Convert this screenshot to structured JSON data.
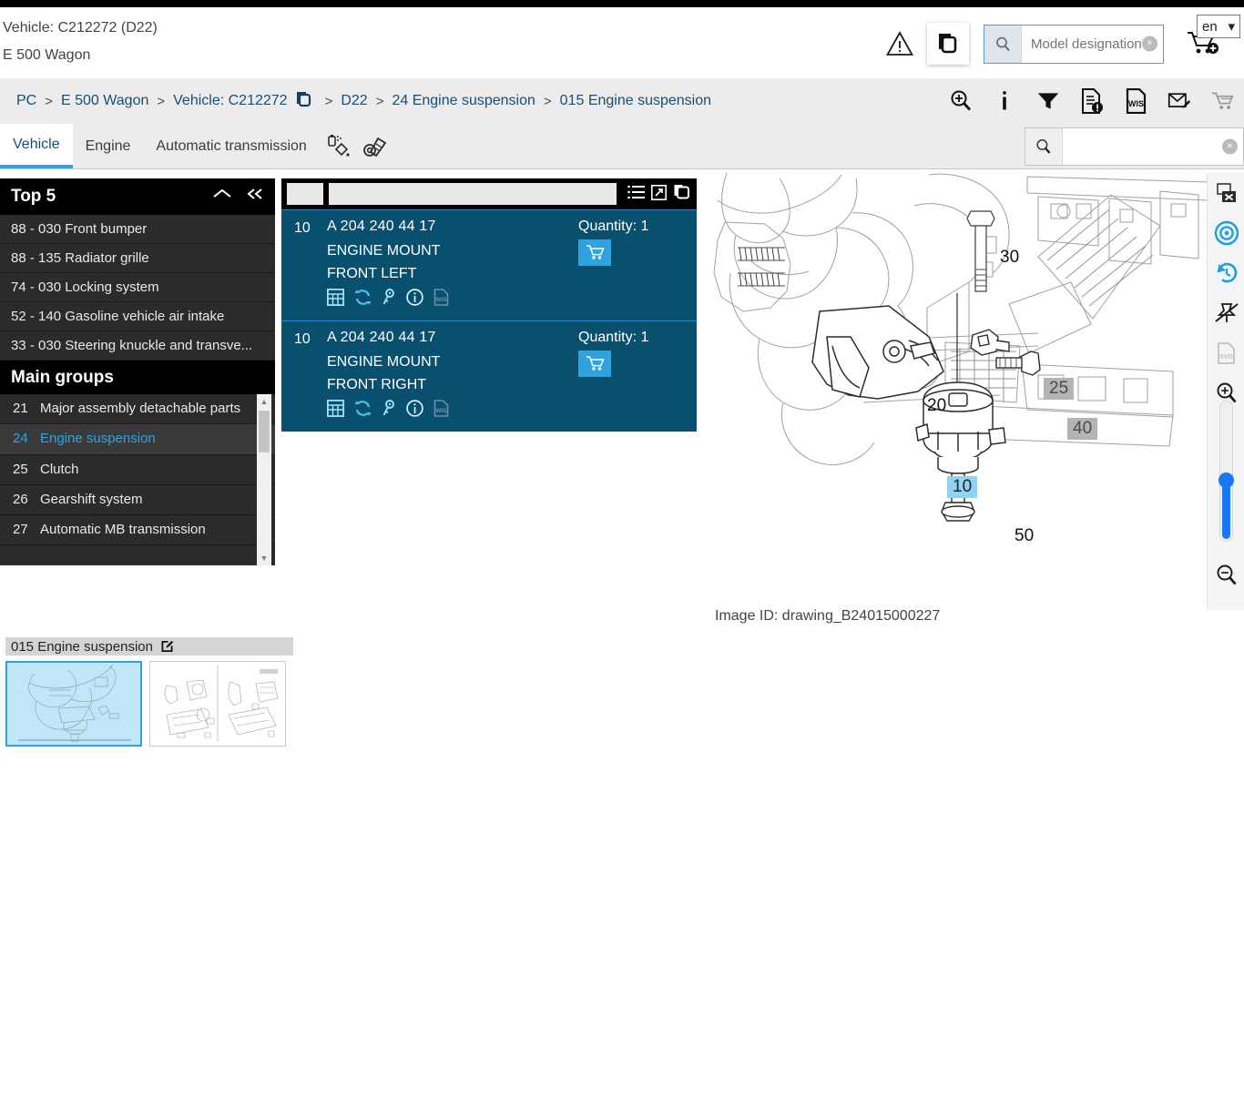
{
  "header": {
    "vehicle_title": "Vehicle: C212272 (D22)",
    "vehicle_model": "E 500 Wagon",
    "warning_icon": "warning-triangle-icon",
    "copy_icon": "copy-documents-icon",
    "search": {
      "placeholder": "Model designation",
      "value": "",
      "icon": "search-icon",
      "clear": "×"
    },
    "cart_icon": "add-to-cart-icon",
    "language": {
      "value": "en",
      "caret": "▾"
    }
  },
  "breadcrumb": {
    "items": [
      {
        "label": "PC"
      },
      {
        "label": "E 500 Wagon"
      },
      {
        "label": "Vehicle: C212272"
      },
      {
        "label": "D22"
      },
      {
        "label": "24 Engine suspension"
      },
      {
        "label": "015 Engine suspension"
      }
    ],
    "separator": ">",
    "tools": [
      {
        "name": "zoom-in-search-icon"
      },
      {
        "name": "info-icon"
      },
      {
        "name": "filter-icon"
      },
      {
        "name": "document-alert-icon"
      },
      {
        "name": "wis-document-icon"
      },
      {
        "name": "email-edit-icon"
      },
      {
        "name": "shopping-cart-icon"
      }
    ]
  },
  "tabs": {
    "items": [
      {
        "label": "Vehicle",
        "active": true
      },
      {
        "label": "Engine",
        "active": false
      },
      {
        "label": "Automatic transmission",
        "active": false
      }
    ],
    "icons": [
      {
        "name": "paint-color-icon"
      },
      {
        "name": "fastener-bolt-icon"
      }
    ],
    "search": {
      "placeholder": "",
      "value": "",
      "icon": "search-icon",
      "clear": "×"
    }
  },
  "sidebar": {
    "top5": {
      "title": "Top 5",
      "collapse_icon": "chevron-up-icon",
      "collapse_all_icon": "double-chevron-left-icon",
      "items": [
        {
          "label": "88 - 030 Front bumper"
        },
        {
          "label": "88 - 135 Radiator grille"
        },
        {
          "label": "74 - 030 Locking system"
        },
        {
          "label": "52 - 140 Gasoline vehicle air intake"
        },
        {
          "label": "33 - 030 Steering knuckle and transve..."
        }
      ]
    },
    "main_groups": {
      "title": "Main groups",
      "items": [
        {
          "num": "21",
          "label": "Major assembly detachable parts",
          "selected": false
        },
        {
          "num": "24",
          "label": "Engine suspension",
          "selected": true
        },
        {
          "num": "25",
          "label": "Clutch",
          "selected": false
        },
        {
          "num": "26",
          "label": "Gearshift system",
          "selected": false
        },
        {
          "num": "27",
          "label": "Automatic MB transmission",
          "selected": false
        }
      ]
    }
  },
  "parts_panel": {
    "header": {
      "list_view_icon": "list-view-icon",
      "expand_icon": "expand-diagonal-icon",
      "copy_icon": "copy-icon"
    },
    "rows": [
      {
        "index": "10",
        "part_number": "A 204 240 44 17",
        "desc_line1": "ENGINE MOUNT",
        "desc_line2": "FRONT LEFT",
        "quantity_label": "Quantity: 1",
        "cart_icon": "cart-icon",
        "icons": [
          {
            "name": "table-grid-icon"
          },
          {
            "name": "refresh-cycle-icon"
          },
          {
            "name": "key-icon"
          },
          {
            "name": "info-circle-icon"
          },
          {
            "name": "wis-document-icon"
          }
        ]
      },
      {
        "index": "10",
        "part_number": "A 204 240 44 17",
        "desc_line1": "ENGINE MOUNT",
        "desc_line2": "FRONT RIGHT",
        "quantity_label": "Quantity: 1",
        "cart_icon": "cart-icon",
        "icons": [
          {
            "name": "table-grid-icon"
          },
          {
            "name": "refresh-cycle-icon"
          },
          {
            "name": "key-icon"
          },
          {
            "name": "info-circle-icon"
          },
          {
            "name": "wis-document-icon"
          }
        ]
      }
    ]
  },
  "drawing": {
    "image_id_label": "Image ID: drawing_B24015000227",
    "callouts": [
      {
        "label": "30",
        "style": "plain"
      },
      {
        "label": "20",
        "style": "plain"
      },
      {
        "label": "25",
        "style": "gray"
      },
      {
        "label": "40",
        "style": "gray"
      },
      {
        "label": "10",
        "style": "blue"
      },
      {
        "label": "50",
        "style": "plain"
      }
    ]
  },
  "right_toolbar": {
    "items": [
      {
        "name": "close-window-icon"
      },
      {
        "name": "target-focus-icon"
      },
      {
        "name": "reset-history-icon"
      },
      {
        "name": "unpin-icon"
      },
      {
        "name": "svg-export-icon"
      },
      {
        "name": "zoom-in-icon"
      },
      {
        "name": "zoom-slider"
      },
      {
        "name": "zoom-out-icon"
      }
    ]
  },
  "thumbnails": {
    "title": "015 Engine suspension",
    "edit_icon": "edit-pencil-icon",
    "items": [
      {
        "name": "engine-suspension-drawing-1",
        "selected": true
      },
      {
        "name": "engine-suspension-drawing-2",
        "selected": false
      }
    ]
  },
  "colors": {
    "accent_blue": "#2ea3e0",
    "panel_blue": "#09506f",
    "link_blue": "#1b4d73",
    "dark_bg": "#2b2b2b",
    "slider_blue": "#1877f2"
  }
}
